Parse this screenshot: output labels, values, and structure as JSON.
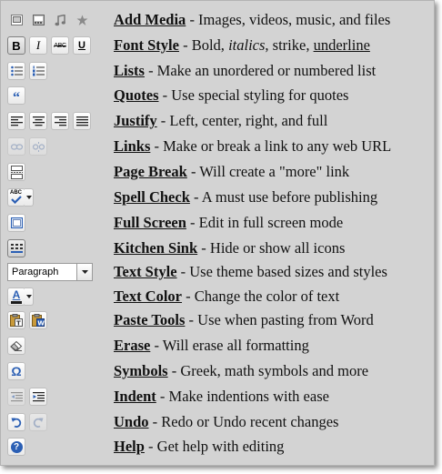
{
  "rows": [
    {
      "term": "Add Media",
      "desc": " - Images, videos, music, and files"
    },
    {
      "term": "Font Style",
      "desc": " - Bold, ",
      "italic": "italics",
      "desc2": ", strike, ",
      "underline": "underline"
    },
    {
      "term": "Lists",
      "desc": " - Make an unordered or numbered list"
    },
    {
      "term": "Quotes",
      "desc": " - Use special styling for quotes"
    },
    {
      "term": "Justify",
      "desc": " - Left, center, right, and full"
    },
    {
      "term": "Links",
      "desc": " - Make or break a link to any web URL"
    },
    {
      "term": "Page Break",
      "desc": " - Will create a \"more\" link"
    },
    {
      "term": "Spell Check",
      "desc": " - A must use before publishing"
    },
    {
      "term": "Full Screen",
      "desc": " - Edit in full screen mode"
    },
    {
      "term": "Kitchen Sink",
      "desc": " - Hide or show all icons"
    },
    {
      "term": "Text Style",
      "desc": " - Use theme based sizes and styles"
    },
    {
      "term": "Text Color",
      "desc": " - Change the color of text"
    },
    {
      "term": "Paste Tools",
      "desc": " - Use when pasting from Word"
    },
    {
      "term": "Erase",
      "desc": " - Will erase all formatting"
    },
    {
      "term": "Symbols",
      "desc": " - Greek, math symbols and more"
    },
    {
      "term": "Indent",
      "desc": " - Make indentions with ease"
    },
    {
      "term": "Undo",
      "desc": " - Redo or Undo recent changes"
    },
    {
      "term": "Help",
      "desc": " - Get help with editing"
    }
  ],
  "toolbar": {
    "bold_glyph": "B",
    "italic_glyph": "I",
    "strike_glyph": "ABC",
    "underline_glyph": "U",
    "quote_glyph": "“",
    "spell_glyph": "ABC",
    "format_select_value": "Paragraph",
    "text_color_glyph": "A",
    "text_color_swatch": "#1a1a1a",
    "symbol_glyph": "Ω",
    "help_glyph": "?"
  },
  "colors": {
    "panel": "#d3d3d3",
    "accent_blue": "#2b5fb4"
  }
}
